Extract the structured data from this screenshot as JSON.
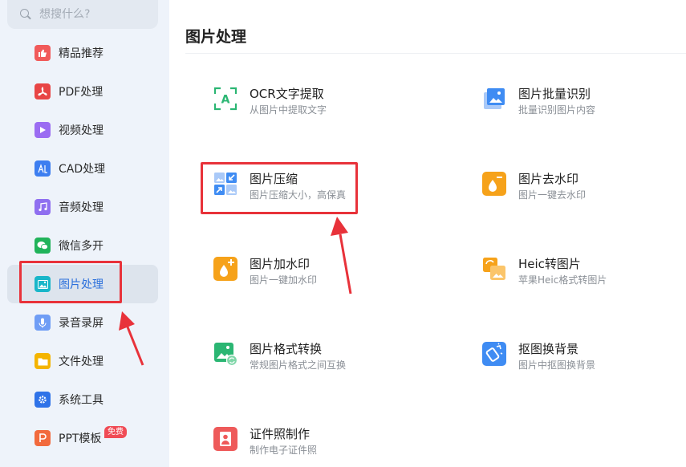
{
  "search": {
    "placeholder": "想搜什么?"
  },
  "sidebar": {
    "items": [
      {
        "label": "精品推荐",
        "icon": "thumbs-up-icon",
        "color": "#f15a5a"
      },
      {
        "label": "PDF处理",
        "icon": "pdf-icon",
        "color": "#e84545"
      },
      {
        "label": "视频处理",
        "icon": "video-play-icon",
        "color": "#9b6cf2"
      },
      {
        "label": "CAD处理",
        "icon": "cad-icon",
        "color": "#3d7ef0"
      },
      {
        "label": "音频处理",
        "icon": "music-note-icon",
        "color": "#8f6ff0"
      },
      {
        "label": "微信多开",
        "icon": "wechat-icon",
        "color": "#21b35a"
      },
      {
        "label": "图片处理",
        "icon": "image-icon",
        "color": "#19b6c9",
        "active": true
      },
      {
        "label": "录音录屏",
        "icon": "microphone-icon",
        "color": "#6f9df5"
      },
      {
        "label": "文件处理",
        "icon": "folder-icon",
        "color": "#f4b400"
      },
      {
        "label": "系统工具",
        "icon": "gear-icon",
        "color": "#2f73e8"
      },
      {
        "label": "PPT模板",
        "icon": "ppt-icon",
        "color": "#f26a3d",
        "badge": "免费"
      }
    ]
  },
  "main": {
    "title": "图片处理",
    "tools": [
      {
        "name": "OCR文字提取",
        "desc": "从图片中提取文字",
        "icon": "ocr-scan-icon",
        "color": "#2bb673"
      },
      {
        "name": "图片批量识别",
        "desc": "批量识别图片内容",
        "icon": "batch-recognize-icon",
        "color": "#3f8cf3"
      },
      {
        "name": "图片压缩",
        "desc": "图片压缩大小，高保真",
        "icon": "compress-icon",
        "color": "#3f8cf3"
      },
      {
        "name": "图片去水印",
        "desc": "图片一键去水印",
        "icon": "remove-watermark-icon",
        "color": "#f6a21a"
      },
      {
        "name": "图片加水印",
        "desc": "图片一键加水印",
        "icon": "add-watermark-icon",
        "color": "#f6a21a"
      },
      {
        "name": "Heic转图片",
        "desc": "苹果Heic格式转图片",
        "icon": "heic-convert-icon",
        "color": "#f6a21a"
      },
      {
        "name": "图片格式转换",
        "desc": "常规图片格式之间互换",
        "icon": "format-convert-icon",
        "color": "#2bb673"
      },
      {
        "name": "抠图换背景",
        "desc": "图片中抠图换背景",
        "icon": "cutout-icon",
        "color": "#3f8cf3"
      },
      {
        "name": "证件照制作",
        "desc": "制作电子证件照",
        "icon": "id-photo-icon",
        "color": "#ee5a5a"
      }
    ]
  },
  "annotation_color": "#e8323a"
}
